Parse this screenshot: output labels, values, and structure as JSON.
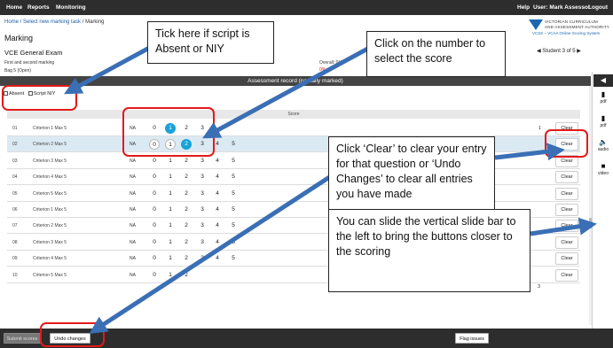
{
  "nav": {
    "home": "Home",
    "reports": "Reports",
    "monitoring": "Monitoring",
    "help": "Help",
    "user": "User: Mark Assessor",
    "logout": "Logout"
  },
  "breadcrumb": {
    "home": "Home",
    "sep1": " / ",
    "select": "Select new marking task",
    "sep2": " / ",
    "current": "Marking"
  },
  "page_title": "Marking",
  "exam": {
    "name": "VCE General Exam",
    "marking_type": "First and second marking",
    "bag": "Bag 5  (Open)",
    "overall_label": "Overall: 0/40",
    "pct_label": "0% co"
  },
  "logo": {
    "line1": "VICTORIAN CURRICULUM",
    "line2": "AND ASSESSMENT AUTHORITY",
    "line3": "VCSS – VCAA Online Scoring System"
  },
  "student_nav": "◀ Student 3 of 5 ▶",
  "assessment_bar": "Assessment record  (partially marked)",
  "absent": {
    "absent_label": "Absent",
    "niy_label": "Script NIY"
  },
  "score_header": "Score",
  "rows": [
    {
      "idx": "01",
      "criterion": "Criterion 1 Max 5",
      "na": "NA",
      "scores": [
        "0",
        "1",
        "2",
        "3"
      ],
      "selected": 1,
      "one": "1",
      "clear": "Clear"
    },
    {
      "idx": "02",
      "criterion": "Criterion 2 Max 5",
      "na": "NA",
      "scores": [
        "0",
        "1",
        "2",
        "3",
        "4",
        "5"
      ],
      "selected": 2,
      "clear": "Clear"
    },
    {
      "idx": "03",
      "criterion": "Criterion 3 Max 5",
      "na": "NA",
      "scores": [
        "0",
        "1",
        "2",
        "3",
        "4",
        "5"
      ],
      "clear": "Clear"
    },
    {
      "idx": "04",
      "criterion": "Criterion 4 Max 5",
      "na": "NA",
      "scores": [
        "0",
        "1",
        "2",
        "3",
        "4",
        "5"
      ],
      "clear": "Clear"
    },
    {
      "idx": "05",
      "criterion": "Criterion 5 Max 5",
      "na": "NA",
      "scores": [
        "0",
        "1",
        "2",
        "3",
        "4",
        "5"
      ],
      "clear": "Clear"
    },
    {
      "idx": "06",
      "criterion": "Criterion 1 Max 5",
      "na": "NA",
      "scores": [
        "0",
        "1",
        "2",
        "3",
        "4",
        "5"
      ],
      "clear": "Clear"
    },
    {
      "idx": "07",
      "criterion": "Criterion 2 Max 5",
      "na": "NA",
      "scores": [
        "0",
        "1",
        "2",
        "3",
        "4",
        "5"
      ],
      "clear": "Clear"
    },
    {
      "idx": "08",
      "criterion": "Criterion 3 Max 5",
      "na": "NA",
      "scores": [
        "0",
        "1",
        "2",
        "3",
        "4",
        "5"
      ],
      "clear": "Clear"
    },
    {
      "idx": "09",
      "criterion": "Criterion 4 Max 5",
      "na": "NA",
      "scores": [
        "0",
        "1",
        "2",
        "3",
        "4",
        "5"
      ],
      "clear": "Clear"
    },
    {
      "idx": "10",
      "criterion": "Criterion 5 Max 5",
      "na": "NA",
      "scores": [
        "0",
        "1",
        "2"
      ],
      "clear": "Clear"
    }
  ],
  "page_three": "3",
  "side_panel": {
    "collapse": "◀",
    "items": [
      {
        "icon": "document-icon",
        "label": "pdf"
      },
      {
        "icon": "document-icon",
        "label": "pdf"
      },
      {
        "icon": "speaker-icon",
        "label": "audio"
      },
      {
        "icon": "video-camera-icon",
        "label": "video"
      }
    ]
  },
  "bottom": {
    "submit": "Submit scores",
    "undo": "Undo changes",
    "flag": "Flag issues"
  },
  "callouts": {
    "absent": "Tick here if script is Absent  or NIY",
    "number": "Click on the number to select the score",
    "clear": "Click ‘Clear’ to clear your entry for that question or ‘Undo Changes’ to clear all entries you have made",
    "slide": "You can slide the vertical slide bar to the left to bring the buttons  closer to the scoring"
  },
  "colors": {
    "accent": "#1aa2d8",
    "highlight": "#e21a1a",
    "arrow": "#3a6fb5",
    "topbar": "#2d2d2d"
  }
}
